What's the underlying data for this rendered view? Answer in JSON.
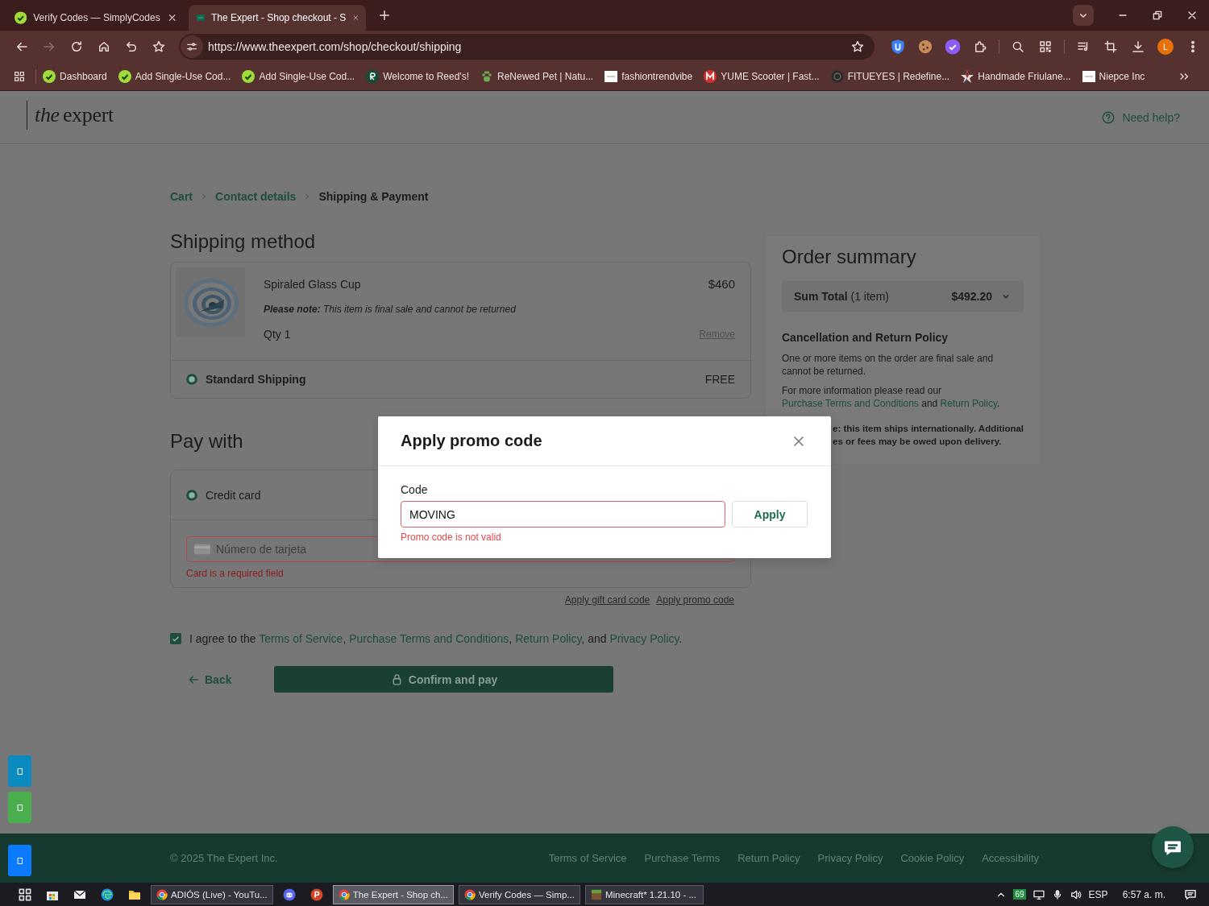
{
  "browser": {
    "tabs": [
      {
        "title": "Verify Codes — SimplyCodes",
        "kind": "check",
        "selected": false
      },
      {
        "title": "The Expert - Shop checkout - S",
        "kind": "site",
        "selected": true
      }
    ],
    "url": "https://www.theexpert.com/shop/checkout/shipping",
    "profile_initial": "L",
    "bookmarks": [
      {
        "title": "Dashboard",
        "kind": "check"
      },
      {
        "title": "Add Single-Use Cod...",
        "kind": "check"
      },
      {
        "title": "Add Single-Use Cod...",
        "kind": "check"
      },
      {
        "title": "Welcome to Reed's!",
        "kind": "dark"
      },
      {
        "title": "ReNewed Pet | Natu...",
        "kind": "paw"
      },
      {
        "title": "fashiontrendvibe",
        "kind": "page"
      },
      {
        "title": "YUME Scooter | Fast...",
        "kind": "red"
      },
      {
        "title": "FITUEYES | Redefine...",
        "kind": "ring"
      },
      {
        "title": "Handmade Friulane...",
        "kind": "star"
      },
      {
        "title": "Niepce Inc",
        "kind": "page"
      }
    ]
  },
  "site_header": {
    "logo_prefix": "the",
    "logo_word": "expert",
    "help": "Need help?"
  },
  "breadcrumb": [
    {
      "label": "Cart",
      "current": false
    },
    {
      "label": "Contact details",
      "current": false
    },
    {
      "label": "Shipping & Payment",
      "current": true
    }
  ],
  "shipping": {
    "title": "Shipping method",
    "item": {
      "name": "Spiraled Glass Cup",
      "price": "$460",
      "note": "**Please note:** This item is final sale and cannot be returned",
      "qty": "Qty 1",
      "remove": "Remove"
    },
    "option": {
      "label": "Standard Shipping",
      "price": "FREE",
      "selected": true
    }
  },
  "payment": {
    "title": "Pay with",
    "method": {
      "label": "Credit card",
      "selected": true
    },
    "card_field": {
      "placeholder": "Número de tarjeta",
      "error": "Card is a required field",
      "invalid": true
    },
    "links": [
      "Apply gift card code",
      "Apply promo code"
    ]
  },
  "agreement": {
    "checked": true,
    "parts": [
      {
        "text": "I agree to the ",
        "kind": "text"
      },
      {
        "text": "Terms of Service",
        "kind": "link"
      },
      {
        "text": ", ",
        "kind": "text"
      },
      {
        "text": "Purchase Terms and Conditions",
        "kind": "link"
      },
      {
        "text": ", ",
        "kind": "text"
      },
      {
        "text": "Return Policy",
        "kind": "link"
      },
      {
        "text": ", and ",
        "kind": "text"
      },
      {
        "text": "Privacy Policy",
        "kind": "link"
      },
      {
        "text": ".",
        "kind": "text"
      }
    ]
  },
  "actions": {
    "back": "Back",
    "confirm": "Confirm and pay"
  },
  "order_summary": {
    "title": "Order summary",
    "total_label": "**Sum Total** (1 item)",
    "total": "$492.20",
    "policy_title": "Cancellation and Return Policy",
    "policy_text": "One or more items on the order are final sale and cannot be returned.",
    "policy_more": [
      {
        "text": "For more information please read our ",
        "kind": "text"
      },
      {
        "text": "Purchase Terms and Conditions",
        "kind": "link"
      },
      {
        "text": " and ",
        "kind": "text"
      },
      {
        "text": "Return Policy",
        "kind": "link"
      },
      {
        "text": ".",
        "kind": "text"
      }
    ],
    "notice_lines": [
      "e: this item ships internationally. Additional",
      "es or fees may be owed upon delivery."
    ]
  },
  "promo_modal": {
    "title": "Apply promo code",
    "field_label": "Code",
    "value": "MOVING",
    "invalid": true,
    "error": "Promo code is not valid",
    "button": "Apply"
  },
  "footer": {
    "copyright": "© 2025 The Expert Inc.",
    "links": [
      "Terms of Service",
      "Purchase Terms",
      "Return Policy",
      "Privacy Policy",
      "Cookie Policy",
      "Accessibility"
    ]
  },
  "taskbar": {
    "windows": [
      {
        "title": "ADIÓS (Live) - YouTu...",
        "kind": "chrome",
        "selected": false
      },
      {
        "title": "The Expert - Shop ch...",
        "kind": "chrome",
        "selected": true
      },
      {
        "title": "Verify Codes — Simp...",
        "kind": "chrome",
        "selected": false
      },
      {
        "title": "Minecraft* 1.21.10 - ...",
        "kind": "block",
        "selected": false
      }
    ],
    "tray_badge": "69",
    "language": "ESP",
    "time": "6:57 a. m."
  }
}
